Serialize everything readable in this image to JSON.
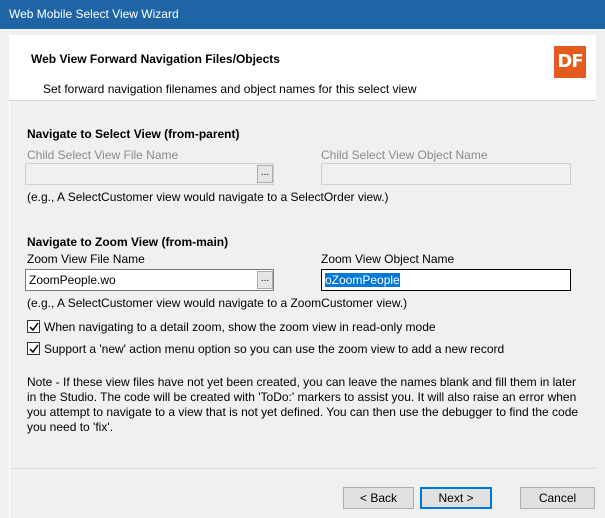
{
  "window": {
    "title": "Web Mobile Select View Wizard"
  },
  "header": {
    "title": "Web View Forward Navigation Files/Objects",
    "subtitle": "Set forward navigation filenames and object names for this select view",
    "logo_text": "DF",
    "logo_color": "#e55a1f"
  },
  "select_view": {
    "section_title": "Navigate to Select View (from-parent)",
    "file_label": "Child Select View File Name",
    "file_value": "",
    "object_label": "Child Select View Object Name",
    "object_value": "",
    "browse_label": "...",
    "example": "(e.g., A SelectCustomer view would navigate to a SelectOrder view.)"
  },
  "zoom_view": {
    "section_title": "Navigate to Zoom View (from-main)",
    "file_label": "Zoom View File Name",
    "file_value": "ZoomPeople.wo",
    "object_label": "Zoom View Object Name",
    "object_value": "oZoomPeople",
    "browse_label": "...",
    "example": "(e.g., A SelectCustomer view would navigate to a ZoomCustomer view.)"
  },
  "options": {
    "readonly_label": "When navigating to a detail zoom, show the zoom view in read-only mode",
    "readonly_checked": true,
    "new_action_label": "Support a 'new' action menu option so you can use the zoom view to add a new record",
    "new_action_checked": true
  },
  "note": "Note - If these view files have not yet been created, you can leave the names blank and fill them in later in the Studio. The code will be created with 'ToDo:' markers to assist you. It will also raise an error when you attempt to navigate to a view that is not yet defined. You can then use the debugger to find the code you need to 'fix'.",
  "buttons": {
    "back": "< Back",
    "next": "Next >",
    "cancel": "Cancel"
  },
  "colors": {
    "titlebar": "#1f65a6",
    "accent": "#0078d7"
  }
}
